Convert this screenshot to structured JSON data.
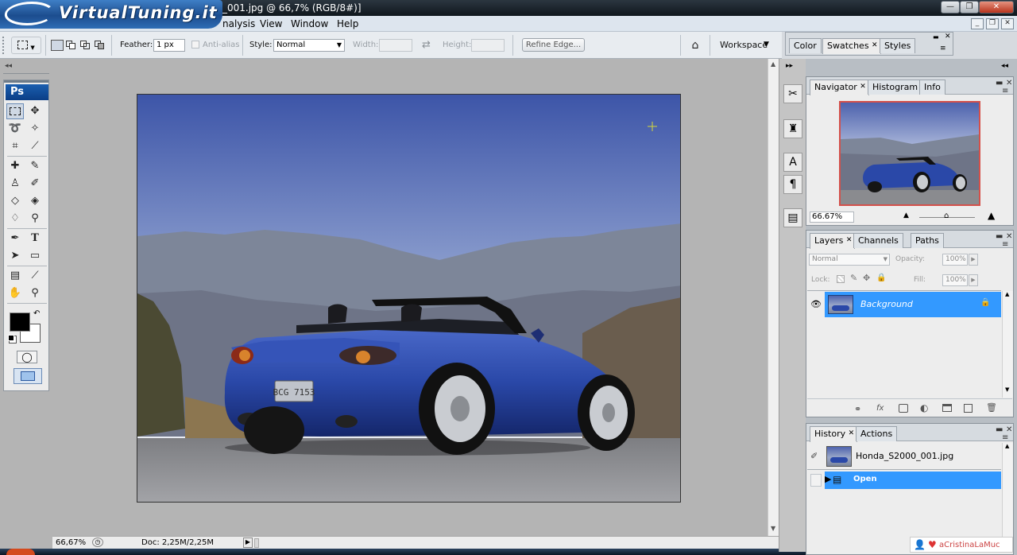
{
  "window": {
    "title": "_001.jpg @ 66,7% (RGB/8#)]",
    "logo_text": "VirtualTuning.it"
  },
  "menu": {
    "items": [
      "nalysis",
      "View",
      "Window",
      "Help"
    ]
  },
  "options": {
    "feather_label": "Feather:",
    "feather_value": "1 px",
    "antialias_label": "Anti-alias",
    "style_label": "Style:",
    "style_value": "Normal",
    "width_label": "Width:",
    "height_label": "Height:",
    "refine_edge": "Refine Edge...",
    "workspace": "Workspace"
  },
  "top_panel": {
    "tabs": [
      "Color",
      "Swatches",
      "Styles"
    ]
  },
  "navigator": {
    "tabs": [
      "Navigator",
      "Histogram",
      "Info"
    ],
    "zoom": "66.67%"
  },
  "layers": {
    "tabs": [
      "Layers",
      "Channels",
      "Paths"
    ],
    "blend_mode": "Normal",
    "opacity_label": "Opacity:",
    "opacity_value": "100%",
    "lock_label": "Lock:",
    "fill_label": "Fill:",
    "fill_value": "100%",
    "layer_name": "Background"
  },
  "history": {
    "tabs": [
      "History",
      "Actions"
    ],
    "snapshot_name": "Honda_S2000_001.jpg",
    "step": "Open"
  },
  "status": {
    "zoom": "66,67%",
    "doc": "Doc: 2,25M/2,25M"
  },
  "watermark": "aCristinaLaMuc",
  "colors": {
    "selection": "#3399ff",
    "car_blue": "#2a48a8",
    "sky_top": "#3d55a8"
  }
}
